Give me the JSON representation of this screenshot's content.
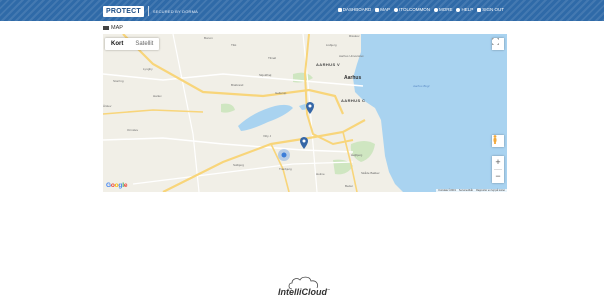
{
  "header": {
    "brand": "PROTECT",
    "brand_sub": "SECURED BY DORMA",
    "nav": [
      {
        "label": "DASHBOARD",
        "icon": "dashboard-icon"
      },
      {
        "label": "MAP",
        "icon": "map-icon"
      },
      {
        "label": "ITOLCOMMON",
        "icon": "gear-icon"
      },
      {
        "label": "MORE",
        "icon": "gear-icon"
      },
      {
        "label": "HELP",
        "icon": "help-icon"
      },
      {
        "label": "SIGN OUT",
        "icon": "signout-icon"
      }
    ],
    "bar_color": "#2f6aa8"
  },
  "section": {
    "label": "MAP"
  },
  "map": {
    "type_buttons": {
      "active": "Kort",
      "inactive": "Satellit"
    },
    "zoom_in": "+",
    "zoom_out": "−",
    "google_label": [
      "G",
      "o",
      "o",
      "g",
      "l",
      "e"
    ],
    "attribution": [
      "Kortdata ©2019",
      "Servicevilkår",
      "Rapportér en fejl på kortet"
    ],
    "places": [
      {
        "name": "Borum",
        "cls": ""
      },
      {
        "name": "Tilst",
        "cls": ""
      },
      {
        "name": "Lisbjerg",
        "cls": ""
      },
      {
        "name": "Tilmøl",
        "cls": ""
      },
      {
        "name": "Lyngby",
        "cls": ""
      },
      {
        "name": "Storring",
        "cls": ""
      },
      {
        "name": "AARHUS V",
        "cls": "major"
      },
      {
        "name": "Aarhus Universitet",
        "cls": ""
      },
      {
        "name": "Aarhus",
        "cls": "big"
      },
      {
        "name": "Risskov",
        "cls": ""
      },
      {
        "name": "Skjoldhøj",
        "cls": ""
      },
      {
        "name": "Brabrand",
        "cls": ""
      },
      {
        "name": "Gellerup",
        "cls": ""
      },
      {
        "name": "AARHUS C",
        "cls": "major"
      },
      {
        "name": "Ormslev",
        "cls": ""
      },
      {
        "name": "Viby J",
        "cls": ""
      },
      {
        "name": "Tranbjerg",
        "cls": ""
      },
      {
        "name": "Holme",
        "cls": ""
      },
      {
        "name": "Højbjerg",
        "cls": ""
      },
      {
        "name": "Skåde Bakker",
        "cls": ""
      },
      {
        "name": "Beder",
        "cls": ""
      },
      {
        "name": "Solbjerg",
        "cls": ""
      },
      {
        "name": "Årslev",
        "cls": ""
      },
      {
        "name": "Harlev",
        "cls": ""
      },
      {
        "name": "Aarhus Bugt",
        "cls": "water"
      }
    ],
    "markers": [
      {
        "name": "map-marker-north"
      },
      {
        "name": "map-marker-south"
      }
    ],
    "colors": {
      "land": "#f1efe7",
      "water": "#a9d3f0",
      "park": "#cfe6c1",
      "motorway": "#f8d57a"
    }
  },
  "footer": {
    "brand": "IntelliCloud",
    "tm": "™"
  }
}
